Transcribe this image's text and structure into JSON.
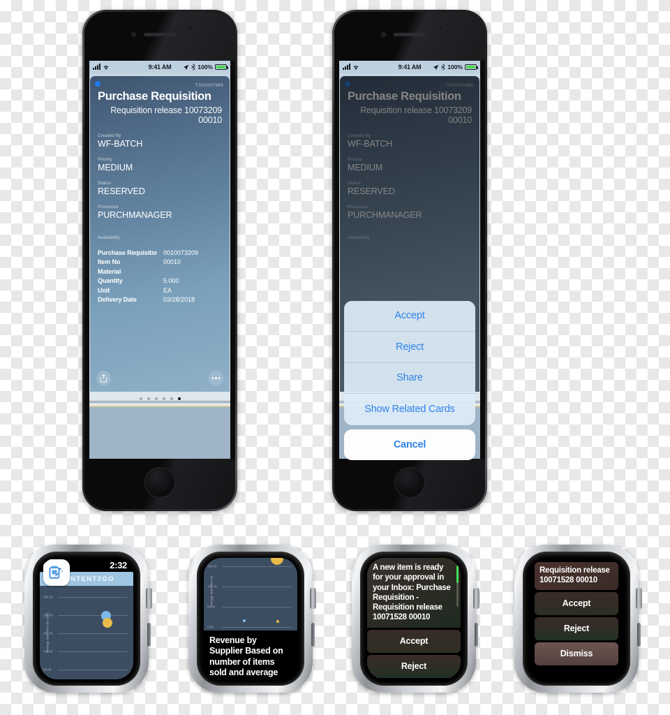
{
  "phones": [
    {
      "id": "phone-card-view",
      "status_bar": {
        "time": "9:41 AM",
        "battery_percent": "100%"
      },
      "card": {
        "code": "TS00007986",
        "title": "Purchase Requisition",
        "subtitle": "Requisition release 10073209 00010",
        "fields": [
          {
            "label": "Created By",
            "value": "WF-BATCH"
          },
          {
            "label": "Priority",
            "value": "MEDIUM"
          },
          {
            "label": "Status",
            "value": "RESERVED"
          },
          {
            "label": "Processor",
            "value": "PURCHMANAGER"
          }
        ],
        "availability_label": "Availability",
        "detail_rows": [
          {
            "key": "Purchase Requisitio",
            "value": "0010073209"
          },
          {
            "key": "Item No",
            "value": "00010"
          },
          {
            "key": "Material",
            "value": ""
          },
          {
            "key": "Quantity",
            "value": "5.000"
          },
          {
            "key": "Unit",
            "value": "EA"
          },
          {
            "key": "Delivery Date",
            "value": "03/28/2018"
          }
        ],
        "share_icon": "share-icon",
        "more_icon": "more-icon"
      },
      "pager": {
        "count": 6,
        "active_index": 5
      }
    },
    {
      "id": "phone-action-sheet-view",
      "status_bar": {
        "time": "9:41 AM",
        "battery_percent": "100%"
      },
      "card": {
        "code": "TS00007986",
        "title": "Purchase Requisition",
        "subtitle": "Requisition release 10073209 00010",
        "fields": [
          {
            "label": "Created By",
            "value": "WF-BATCH"
          },
          {
            "label": "Priority",
            "value": "MEDIUM"
          },
          {
            "label": "Status",
            "value": "RESERVED"
          },
          {
            "label": "Processor",
            "value": "PURCHMANAGER"
          }
        ],
        "availability_label": "Availability"
      },
      "action_sheet": {
        "items": [
          "Accept",
          "Reject",
          "Share",
          "Show Related Cards"
        ],
        "cancel_label": "Cancel"
      }
    }
  ],
  "watches": [
    {
      "id": "watch-app-home",
      "time": "2:32",
      "app_name": "CONTENT2GO",
      "app_icon": "content2go-app-icon",
      "chart": {
        "ylabel": "Average Item Price (in USD)",
        "ticks": [
          "250.00",
          "200.00",
          "150.00",
          "100.00",
          "50.00"
        ],
        "points": [
          {
            "color": "#7fb8e8",
            "label": "supplier-a"
          },
          {
            "color": "#e8bc4a",
            "label": "supplier-b"
          }
        ]
      }
    },
    {
      "id": "watch-chart-caption",
      "chart": {
        "ylabel": "Average Item Price (in",
        "ticks": [
          "150.00",
          "100.00",
          "50.00",
          "0.00"
        ]
      },
      "caption": "Revenue by Supplier Based on number of items sold and average price"
    },
    {
      "id": "watch-notification",
      "message": "A new item is ready for your approval in your Inbox: Purchase Requisition - Requisition release 10071528 00010",
      "actions": [
        "Accept",
        "Reject"
      ]
    },
    {
      "id": "watch-notification-actions",
      "title": "Requisition release 10071528 00010",
      "actions": [
        "Accept",
        "Reject",
        "Dismiss"
      ]
    }
  ],
  "colors": {
    "accent_blue": "#2f84e8",
    "card_top": "#3f5570",
    "card_bottom": "#8fb0c7",
    "status_green": "#4cd551",
    "watch_chart_bg": "#3c4d61",
    "point_blue": "#7fb8e8",
    "point_yellow": "#e8bc4a"
  }
}
